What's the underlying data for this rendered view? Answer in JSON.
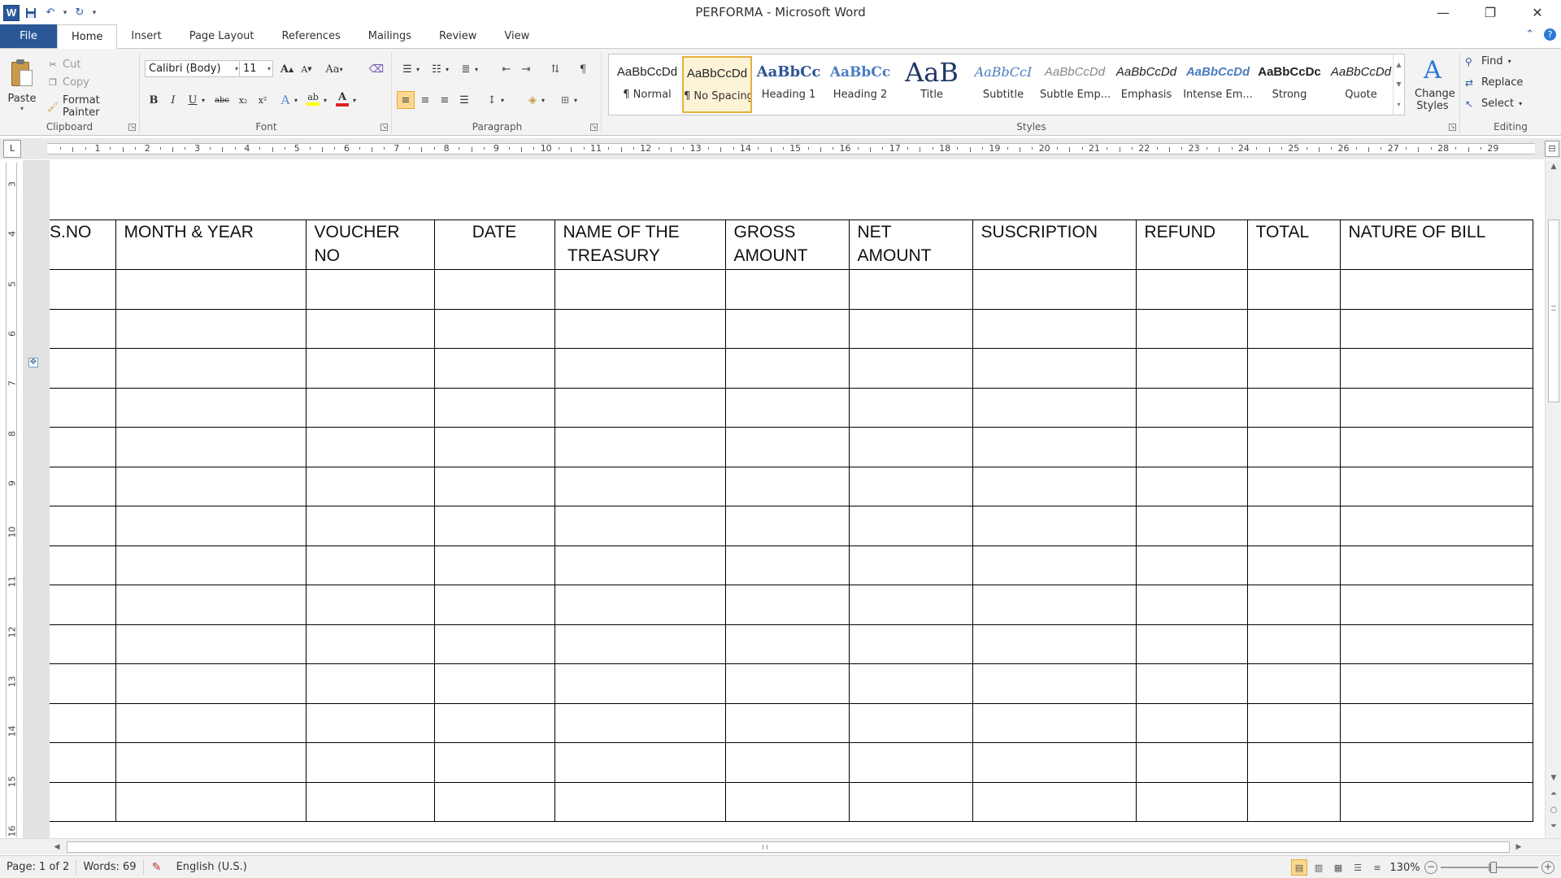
{
  "window": {
    "title": "PERFORMA  -  Microsoft Word",
    "app_icon": "W",
    "controls": [
      "minimize-icon",
      "restore-icon",
      "close-icon"
    ]
  },
  "tabs": [
    {
      "label": "File"
    },
    {
      "label": "Home",
      "active": true
    },
    {
      "label": "Insert"
    },
    {
      "label": "Page Layout"
    },
    {
      "label": "References"
    },
    {
      "label": "Mailings"
    },
    {
      "label": "Review"
    },
    {
      "label": "View"
    }
  ],
  "ribbon": {
    "clipboard": {
      "label": "Clipboard",
      "paste": "Paste",
      "cut": "Cut",
      "copy": "Copy",
      "format_painter": "Format Painter"
    },
    "font": {
      "label": "Font",
      "font_name": "Calibri (Body)",
      "font_size": "11",
      "grow": "A",
      "shrink": "A",
      "change_case": "Aa",
      "bold": "B",
      "italic": "I",
      "underline": "U",
      "strikethrough": "abc",
      "subscript": "x₂",
      "superscript": "x²",
      "text_effects": "A",
      "highlight": "ab",
      "font_color": "A",
      "font_color_value": "#e02020",
      "highlight_color_value": "#ffff00"
    },
    "paragraph": {
      "label": "Paragraph",
      "show_marks": "¶"
    },
    "styles": {
      "label": "Styles",
      "items": [
        {
          "preview": "AaBbCcDd",
          "name": "¶ Normal"
        },
        {
          "preview": "AaBbCcDd",
          "name": "¶ No Spacing",
          "selected": true
        },
        {
          "preview": "AaBbCc",
          "name": "Heading 1"
        },
        {
          "preview": "AaBbCc",
          "name": "Heading 2"
        },
        {
          "preview": "AaB",
          "name": "Title"
        },
        {
          "preview": "AaBbCcI",
          "name": "Subtitle"
        },
        {
          "preview": "AaBbCcDd",
          "name": "Subtle Emp..."
        },
        {
          "preview": "AaBbCcDd",
          "name": "Emphasis"
        },
        {
          "preview": "AaBbCcDd",
          "name": "Intense Em..."
        },
        {
          "preview": "AaBbCcDc",
          "name": "Strong"
        },
        {
          "preview": "AaBbCcDd",
          "name": "Quote"
        }
      ],
      "change_styles": "Change Styles"
    },
    "editing": {
      "label": "Editing",
      "find": "Find",
      "replace": "Replace",
      "select": "Select"
    }
  },
  "ruler": {
    "tab_selector": "L",
    "numbers": [
      "1",
      "2",
      "3",
      "4",
      "5",
      "6",
      "7",
      "8",
      "9",
      "10",
      "11",
      "12",
      "13",
      "14",
      "15",
      "16",
      "17",
      "18",
      "19",
      "20",
      "21",
      "22",
      "23",
      "24",
      "25",
      "26",
      "27",
      "28",
      "29"
    ],
    "vertical_numbers": [
      "3",
      "4",
      "5",
      "6",
      "7",
      "8",
      "9",
      "10",
      "11",
      "12",
      "13",
      "14",
      "15",
      "16"
    ]
  },
  "table": {
    "headers": [
      "S.NO",
      "MONTH & YEAR",
      "VOUCHER NO",
      "DATE",
      "NAME OF THE TREASURY",
      "GROSS AMOUNT",
      "NET AMOUNT",
      "SUSCRIPTION",
      "REFUND",
      "TOTAL",
      "NATURE OF BILL"
    ],
    "header_lines": [
      [
        "S.NO"
      ],
      [
        "MONTH & YEAR"
      ],
      [
        "VOUCHER",
        "NO"
      ],
      [
        "DATE"
      ],
      [
        "NAME OF THE",
        " TREASURY"
      ],
      [
        "GROSS",
        "AMOUNT"
      ],
      [
        "NET",
        "AMOUNT"
      ],
      [
        "SUSCRIPTION"
      ],
      [
        "REFUND"
      ],
      [
        "TOTAL"
      ],
      [
        "NATURE OF BILL"
      ]
    ],
    "empty_rows": 14
  },
  "status": {
    "page": "Page: 1 of 2",
    "words": "Words: 69",
    "language": "English (U.S.)",
    "zoom": "130%",
    "zoom_percent": 130
  }
}
